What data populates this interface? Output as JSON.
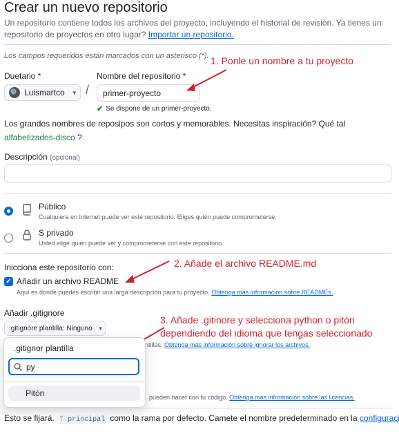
{
  "header": {
    "title": "Crear un nuevo repositorio",
    "subtitle_line1": "Un repositorio contiene todos los archivos del proyecto, incluyendo el historial de revisión. Ya tienes un",
    "subtitle_line2": "repositorio de proyectos en otro lugar?",
    "import_link": "Importar un repositorio."
  },
  "required_note": "Los campos requeridos están marcados con un asterisco (*).",
  "owner": {
    "label": "Duetario *",
    "value": "Luismartco"
  },
  "separator": "/",
  "repo_name": {
    "label": "Nombre del repositorio *",
    "value": "primer-proyecto",
    "availability": "Se dispone de un primer-proyecto."
  },
  "suggestion": {
    "text": "Los grandes nombres de reposipos son cortos y memorables. Necesitas inspiración? Qué tal",
    "name": "alfabetizados-disco",
    "end": "?"
  },
  "description": {
    "label": "Descripción",
    "optional": "(opcional)",
    "value": ""
  },
  "visibility": {
    "public": {
      "title": "Público",
      "desc": "Cualquiera en Internet puede ver este repositorio. Eliges quién puede comprometerse.",
      "selected": true
    },
    "private": {
      "title": "S privado",
      "desc": "Usted elige quién puede ver y comprometerse con este repositorio.",
      "selected": false
    }
  },
  "init": {
    "heading": "Inicciona este repositorio con:",
    "readme_label": "Añadir un archivo README",
    "readme_checked": true,
    "readme_desc": "Aquí es donde puedes escribir una larga descripción para tu proyecto.",
    "readme_link": "Obtenga más información sobre READMEs."
  },
  "gitignore": {
    "label": "Añadir .gitignore",
    "button": ".gitignore plantilla: Ninguno",
    "partial_desc": "ntillas.",
    "link": "Obtenga más información sobre ignorar los archivos."
  },
  "popover": {
    "title": ".gitignor plantilla",
    "search_value": "py",
    "result": "Pitón"
  },
  "license": {
    "partial_desc": "pueden hacer con tu código.",
    "link": "Obtenga más información sobre las licencias."
  },
  "branch": {
    "pre": "Esto se fijará.",
    "name": "principal",
    "post": "como la rama por defecto. Camete el nombre predeterminado en la",
    "link": "configuración",
    "end": "."
  },
  "annotations": {
    "a1": "1. Ponle un nombre a tu proyecto",
    "a2": "2. Añade el archivo README.md",
    "a3_line1": "3. Añade .gitinore y selecciona python o pitón",
    "a3_line2": "dependiendo del idioma que tengas seleccionado",
    "a3_line3": "3. Añade .gitinore y selecciona python o pitón"
  },
  "colors": {
    "annotation": "#cf222e",
    "link": "#0969da",
    "primary": "#0969da",
    "success": "#1a7f37"
  }
}
